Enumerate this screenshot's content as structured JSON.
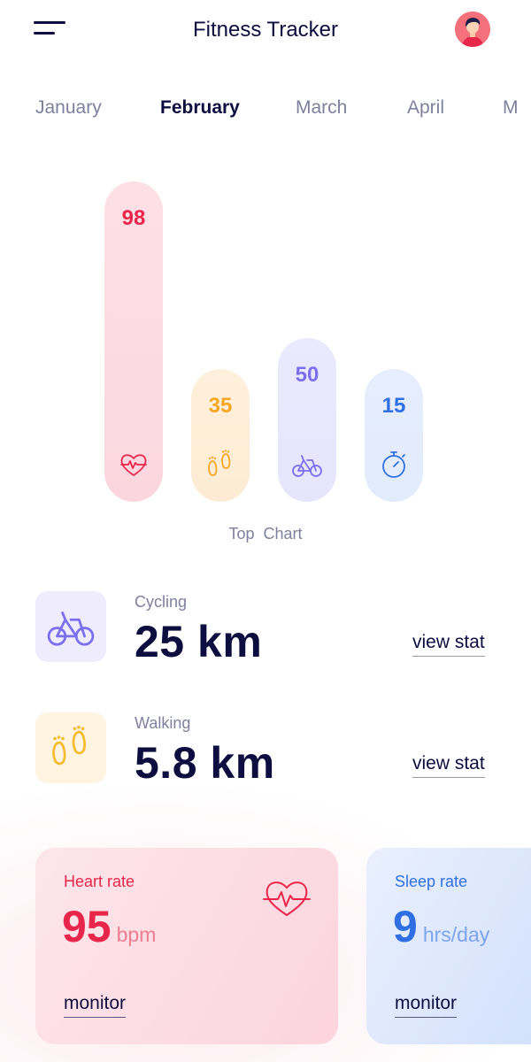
{
  "header": {
    "title": "Fitness Tracker",
    "menu_icon": "hamburger-menu-icon",
    "avatar_icon": "user-avatar"
  },
  "months": {
    "items": [
      "January",
      "February",
      "March",
      "April",
      "M"
    ],
    "selected": "February"
  },
  "chart": {
    "caption": "Top  Chart",
    "colors": {
      "heart": "#e8254a",
      "steps": "#f5a623",
      "cycling": "#7b6ff0",
      "timer": "#2f6fe3"
    }
  },
  "chart_data": {
    "type": "bar",
    "categories": [
      "heart-rate",
      "steps",
      "cycling",
      "timer"
    ],
    "values": [
      98,
      35,
      50,
      15
    ],
    "ylim": [
      0,
      98
    ],
    "title": "Top  Chart",
    "xlabel": "",
    "ylabel": "",
    "icons": [
      "heart-pulse-icon",
      "footprints-icon",
      "bicycle-icon",
      "stopwatch-icon"
    ]
  },
  "activities": [
    {
      "label": "Cycling",
      "value": "25 km",
      "link": "view stat",
      "icon": "bicycle-icon",
      "color": "#7b6ff0"
    },
    {
      "label": "Walking",
      "value": "5.8 km",
      "link": "view stat",
      "icon": "footprints-icon",
      "color": "#f5b92e"
    }
  ],
  "cards": {
    "heart": {
      "title": "Heart rate",
      "value": "95",
      "unit": "bpm",
      "link": "monitor",
      "icon": "heart-pulse-icon",
      "color": "#e8254a"
    },
    "sleep": {
      "title": "Sleep rate",
      "value": "9",
      "unit": "hrs/day",
      "link": "monitor",
      "color": "#2f6fe3"
    }
  }
}
